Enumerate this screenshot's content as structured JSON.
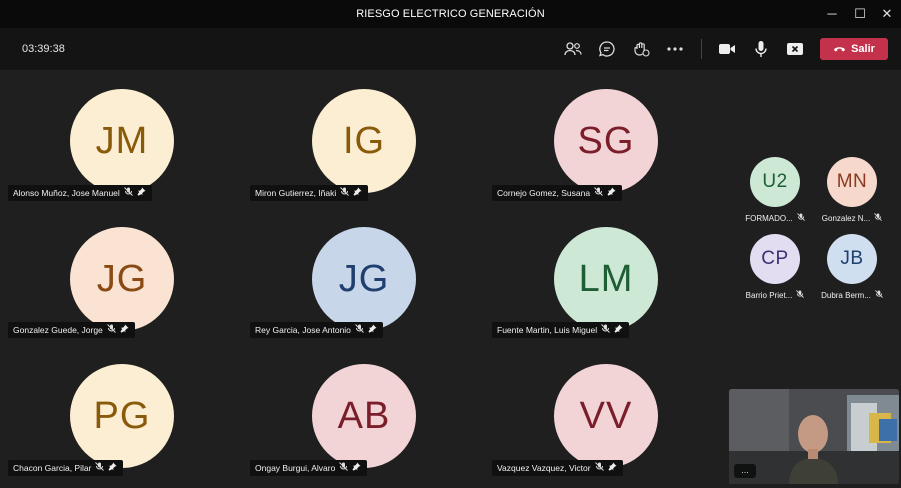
{
  "window": {
    "title": "RIESGO ELECTRICO GENERACIÓN"
  },
  "toolbar": {
    "timer": "03:39:38",
    "leave_label": "Salir"
  },
  "participants": [
    {
      "initials": "JM",
      "name": "Alonso Muñoz, Jose Manuel",
      "bg": "#fbeed3",
      "fg": "#8a5a0b"
    },
    {
      "initials": "IG",
      "name": "Miron Gutierrez, Iñaki",
      "bg": "#fbeed3",
      "fg": "#8a5a0b"
    },
    {
      "initials": "SG",
      "name": "Cornejo Gomez, Susana",
      "bg": "#f2d4d7",
      "fg": "#7a1e2a"
    },
    {
      "initials": "JG",
      "name": "Gonzalez Guede, Jorge",
      "bg": "#fbe3d3",
      "fg": "#8a4a14"
    },
    {
      "initials": "JG",
      "name": "Rey Garcia, Jose Antonio",
      "bg": "#c8d6ea",
      "fg": "#1f3f6e"
    },
    {
      "initials": "LM",
      "name": "Fuente Martin, Luis Miguel",
      "bg": "#cde9d6",
      "fg": "#1d5e35"
    },
    {
      "initials": "PG",
      "name": "Chacon Garcia, Pilar",
      "bg": "#fbeed3",
      "fg": "#8a5a0b"
    },
    {
      "initials": "AB",
      "name": "Ongay Burgui, Alvaro",
      "bg": "#f2d4d7",
      "fg": "#7a1e2a"
    },
    {
      "initials": "VV",
      "name": "Vazquez Vazquez, Victor",
      "bg": "#f2d4d7",
      "fg": "#7a1e2a"
    }
  ],
  "side_participants": [
    {
      "initials": "U2",
      "name": "FORMADO...",
      "bg": "#cde9d6",
      "fg": "#1d5e35"
    },
    {
      "initials": "MN",
      "name": "Gonzalez N...",
      "bg": "#f6d8cc",
      "fg": "#8a3a1e"
    },
    {
      "initials": "CP",
      "name": "Barrio Priet...",
      "bg": "#e3ddf2",
      "fg": "#3e2f72"
    },
    {
      "initials": "JB",
      "name": "Dubra Berm...",
      "bg": "#cfdff0",
      "fg": "#1f3f6e"
    }
  ],
  "selfview": {
    "more_label": "..."
  }
}
